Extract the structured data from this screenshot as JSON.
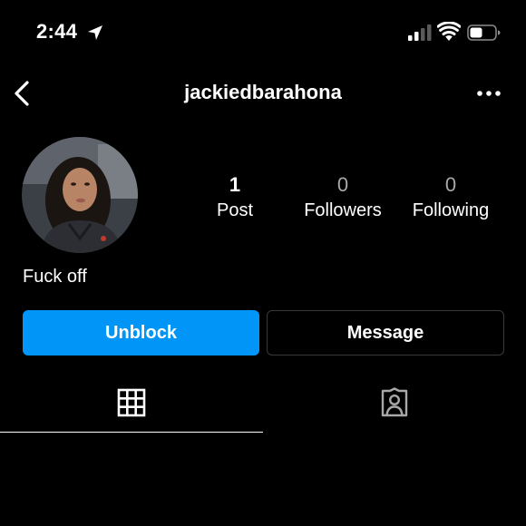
{
  "status_bar": {
    "time": "2:44",
    "icons": [
      "location-arrow-icon",
      "cellular-signal-icon",
      "wifi-icon",
      "battery-icon"
    ]
  },
  "header": {
    "username": "jackiedbarahona",
    "back_icon": "chevron-left-icon",
    "more_icon": "more-horizontal-icon"
  },
  "profile": {
    "stats": [
      {
        "count": "1",
        "label": "Post"
      },
      {
        "count": "0",
        "label": "Followers"
      },
      {
        "count": "0",
        "label": "Following"
      }
    ],
    "bio": "Fuck off"
  },
  "actions": {
    "unblock_label": "Unblock",
    "message_label": "Message"
  },
  "tabs": [
    {
      "icon": "grid-icon",
      "active": true
    },
    {
      "icon": "tagged-person-icon",
      "active": false
    }
  ],
  "colors": {
    "background": "#000000",
    "accent": "#0095f6",
    "text": "#ffffff",
    "muted": "#a8a8a8"
  }
}
